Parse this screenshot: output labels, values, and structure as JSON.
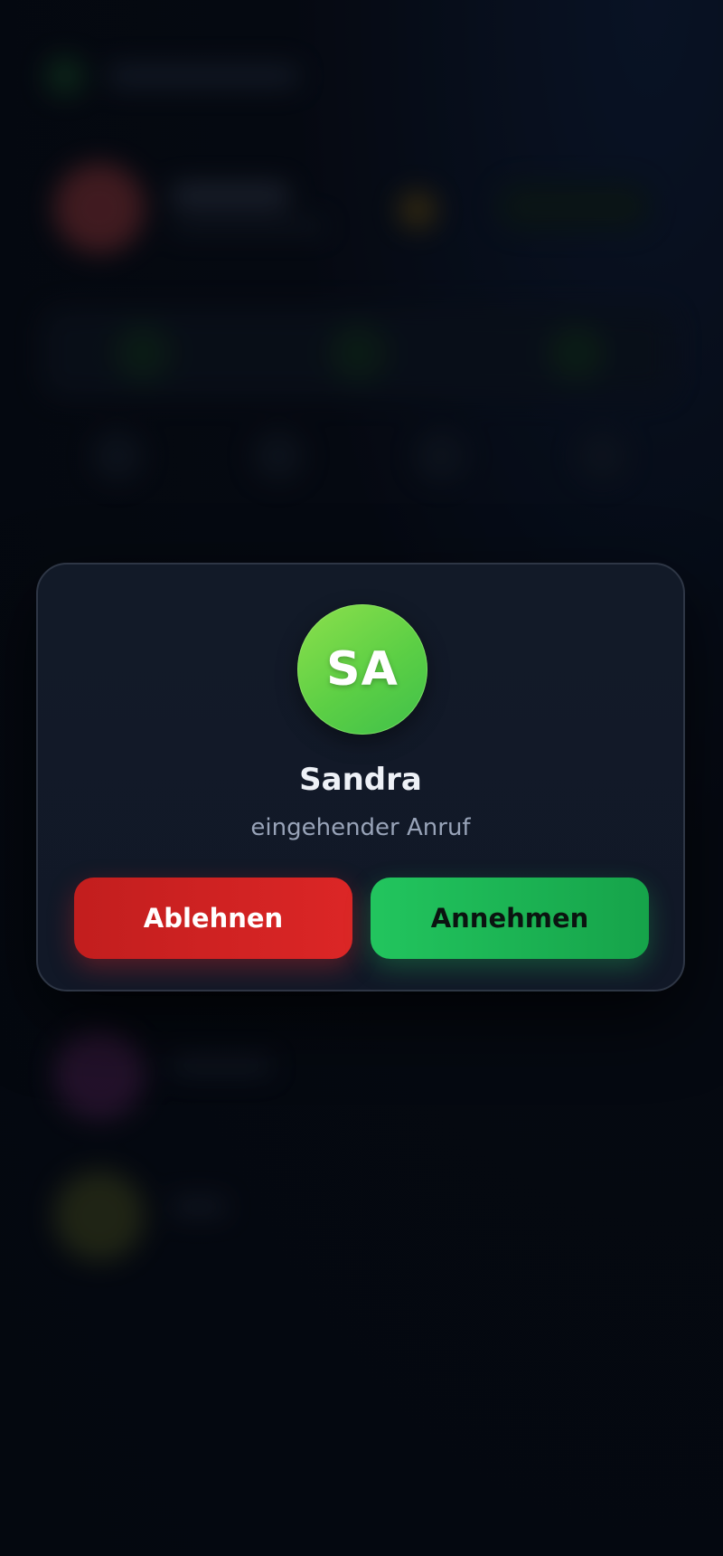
{
  "call": {
    "avatar_initials": "SA",
    "caller_name": "Sandra",
    "status": "eingehender Anruf",
    "decline_label": "Ablehnen",
    "accept_label": "Annehmen"
  },
  "colors": {
    "decline": "#dc2626",
    "accept": "#22c55e",
    "avatar": "#5ccf45",
    "dialog_background": "#111827"
  }
}
